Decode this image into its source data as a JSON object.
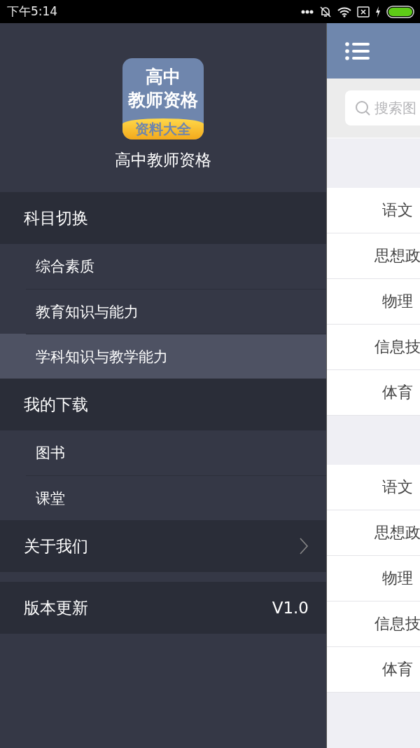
{
  "status_bar": {
    "time": "下午5:14"
  },
  "drawer": {
    "logo": {
      "line_1": "高中",
      "line_2": "教师资格",
      "ribbon": "资料大全"
    },
    "app_name": "高中教师资格",
    "menu": [
      {
        "kind": "group",
        "title": "科目切换",
        "items": [
          {
            "label": "综合素质",
            "selected": false
          },
          {
            "label": "教育知识与能力",
            "selected": false
          },
          {
            "label": "学科知识与教学能力",
            "selected": true
          }
        ]
      },
      {
        "kind": "group",
        "title": "我的下载",
        "items": [
          {
            "label": "图书",
            "selected": false
          },
          {
            "label": "课堂",
            "selected": false
          }
        ]
      },
      {
        "kind": "link",
        "title": "关于我们"
      },
      {
        "kind": "value",
        "title": "版本更新",
        "value": "V1.0"
      }
    ]
  },
  "main": {
    "search": {
      "placeholder": "搜索图"
    },
    "lists": [
      {
        "items": [
          "语文",
          "思想政",
          "物理",
          "信息技",
          "体育"
        ]
      },
      {
        "items": [
          "语文",
          "思想政",
          "物理",
          "信息技",
          "体育"
        ]
      }
    ]
  }
}
